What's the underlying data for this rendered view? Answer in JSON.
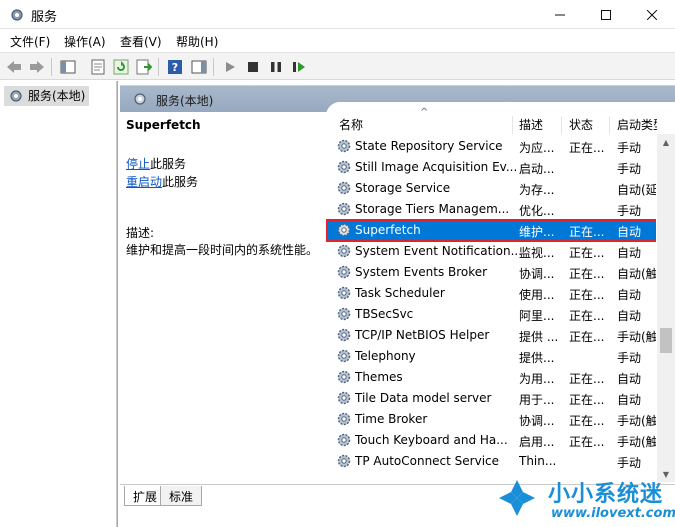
{
  "window": {
    "title": "服务",
    "min_icon": "minimize-icon",
    "max_icon": "maximize-icon",
    "close_icon": "close-icon"
  },
  "menu": [
    "文件(F)",
    "操作(A)",
    "查看(V)",
    "帮助(H)"
  ],
  "toolbar_icons": [
    "back-icon",
    "forward-icon",
    "show-console-tree-icon",
    "properties-icon",
    "refresh-icon",
    "export-list-icon",
    "help-icon",
    "action-pane-icon",
    "start-service-icon",
    "stop-service-icon",
    "pause-service-icon",
    "restart-service-icon"
  ],
  "tree": {
    "item": "服务(本地)"
  },
  "right_header": {
    "title": "服务(本地)"
  },
  "details": {
    "service_name": "Superfetch",
    "stop_link": "停止",
    "stop_suffix": "此服务",
    "restart_link": "重启动",
    "restart_suffix": "此服务",
    "desc_label": "描述:",
    "desc_text": "维护和提高一段时间内的系统性能。"
  },
  "columns": {
    "name": "名称",
    "desc": "描述",
    "status": "状态",
    "startup": "启动类型"
  },
  "services": [
    {
      "name": "State Repository Service",
      "desc": "为应...",
      "status": "正在...",
      "startup": "手动"
    },
    {
      "name": "Still Image Acquisition Ev...",
      "desc": "启动...",
      "status": "",
      "startup": "手动"
    },
    {
      "name": "Storage Service",
      "desc": "为存...",
      "status": "",
      "startup": "自动(延迟..."
    },
    {
      "name": "Storage Tiers Managem...",
      "desc": "优化...",
      "status": "",
      "startup": "手动"
    },
    {
      "name": "Superfetch",
      "desc": "维护...",
      "status": "正在...",
      "startup": "自动",
      "selected": true
    },
    {
      "name": "System Event Notification...",
      "desc": "监视...",
      "status": "正在...",
      "startup": "自动"
    },
    {
      "name": "System Events Broker",
      "desc": "协调...",
      "status": "正在...",
      "startup": "自动(触..."
    },
    {
      "name": "Task Scheduler",
      "desc": "使用...",
      "status": "正在...",
      "startup": "自动"
    },
    {
      "name": "TBSecSvc",
      "desc": "阿里...",
      "status": "正在...",
      "startup": "自动"
    },
    {
      "name": "TCP/IP NetBIOS Helper",
      "desc": "提供 ...",
      "status": "正在...",
      "startup": "手动(触..."
    },
    {
      "name": "Telephony",
      "desc": "提供...",
      "status": "",
      "startup": "手动"
    },
    {
      "name": "Themes",
      "desc": "为用...",
      "status": "正在...",
      "startup": "自动"
    },
    {
      "name": "Tile Data model server",
      "desc": "用于...",
      "status": "正在...",
      "startup": "自动"
    },
    {
      "name": "Time Broker",
      "desc": "协调...",
      "status": "正在...",
      "startup": "手动(触..."
    },
    {
      "name": "Touch Keyboard and Ha...",
      "desc": "启用...",
      "status": "正在...",
      "startup": "手动(触..."
    },
    {
      "name": "TP AutoConnect Service",
      "desc": "Thin...",
      "status": "",
      "startup": "手动"
    }
  ],
  "tabs": {
    "extended": "扩展",
    "standard": "标准"
  },
  "watermark": {
    "text": "小小系统迷",
    "url": "www.ilovext.com"
  },
  "colors": {
    "selection": "#0078d7",
    "highlight_border": "#e0242a",
    "header_bar": "#a9b9cc",
    "link": "#0a56c7"
  }
}
